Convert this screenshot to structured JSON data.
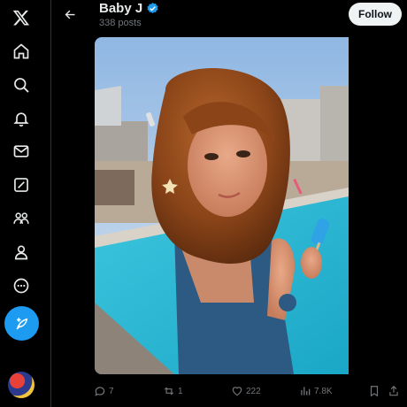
{
  "nav": {
    "items": [
      {
        "icon": "x-logo-icon"
      },
      {
        "icon": "home-icon"
      },
      {
        "icon": "search-icon"
      },
      {
        "icon": "bell-icon"
      },
      {
        "icon": "mail-icon"
      },
      {
        "icon": "grok-icon"
      },
      {
        "icon": "communities-icon"
      },
      {
        "icon": "profile-icon"
      },
      {
        "icon": "more-icon"
      }
    ],
    "post_icon": "feather-plus-icon"
  },
  "header": {
    "name": "Baby J",
    "post_count": "338 posts",
    "follow_label": "Follow"
  },
  "actions": {
    "replies": "7",
    "reposts": "1",
    "likes": "222",
    "views": "7.8K"
  },
  "colors": {
    "accent": "#1d9bf0",
    "background": "#000000",
    "muted_text": "#71767b"
  }
}
